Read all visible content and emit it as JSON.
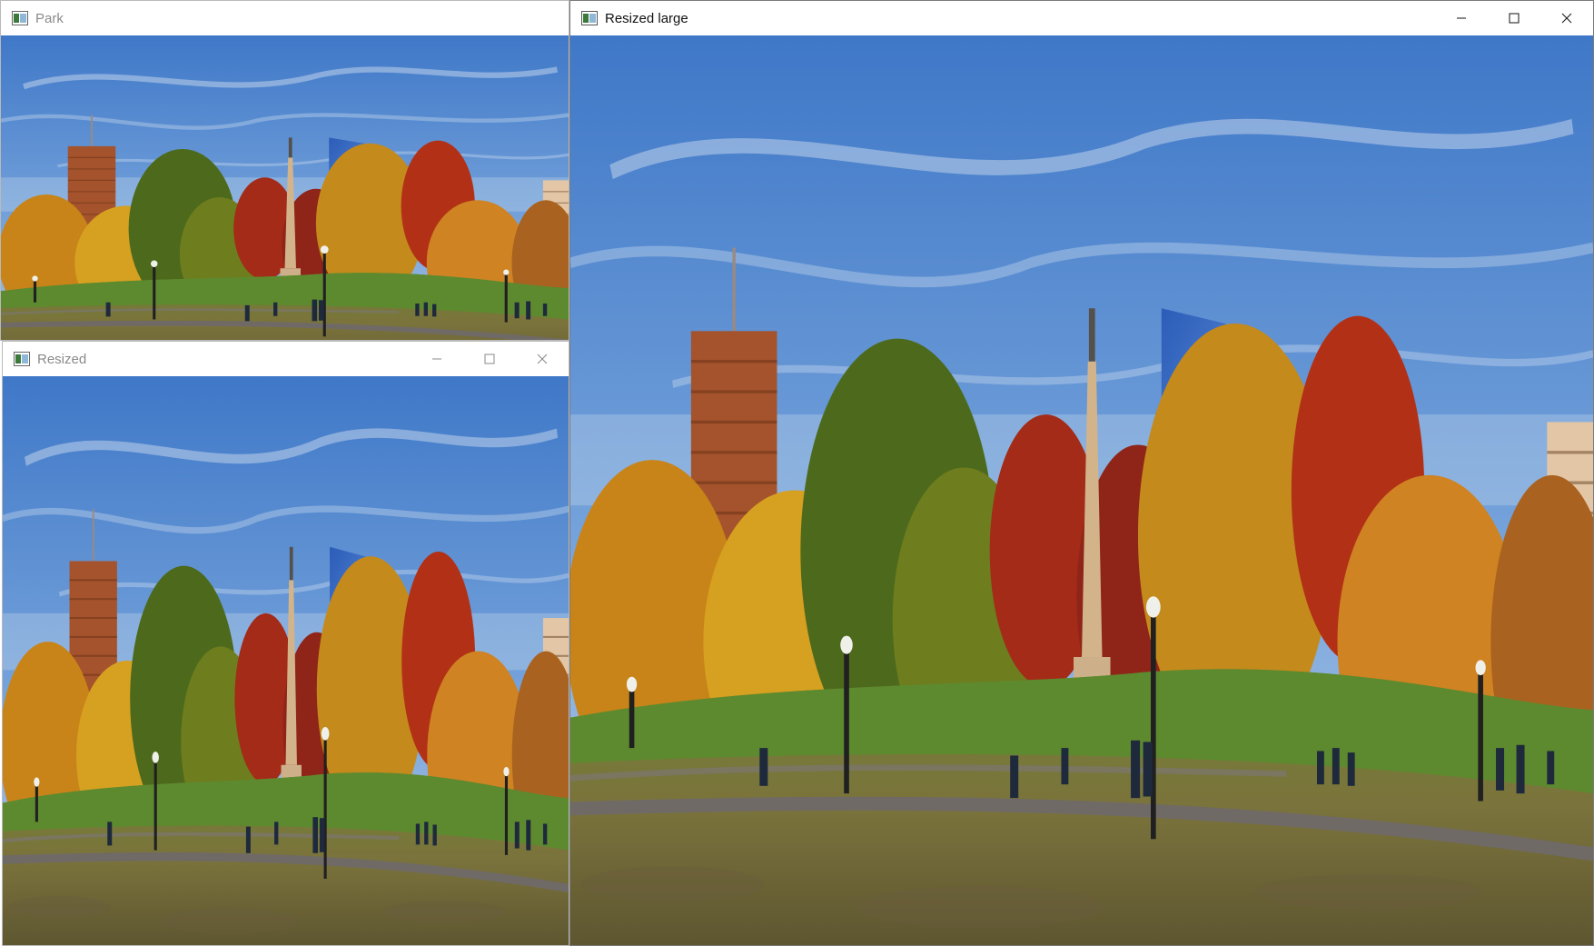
{
  "windows": {
    "park": {
      "title": "Park",
      "icon": "opencv-window-icon",
      "state": "inactive"
    },
    "resized": {
      "title": "Resized",
      "icon": "opencv-window-icon",
      "state": "inactive"
    },
    "resized_large": {
      "title": "Resized large",
      "icon": "opencv-window-icon",
      "state": "active"
    }
  },
  "controls": [
    "minimize-icon",
    "maximize-icon",
    "close-icon"
  ],
  "image": {
    "subject": "park-photo",
    "colors": {
      "sky": "#5d8fd0",
      "grass": "#5f7a2e",
      "ground": "#7a6a3e",
      "tree_orange": "#c98a1a",
      "tree_red": "#9e2b18",
      "tree_green": "#4e6a1e"
    }
  }
}
